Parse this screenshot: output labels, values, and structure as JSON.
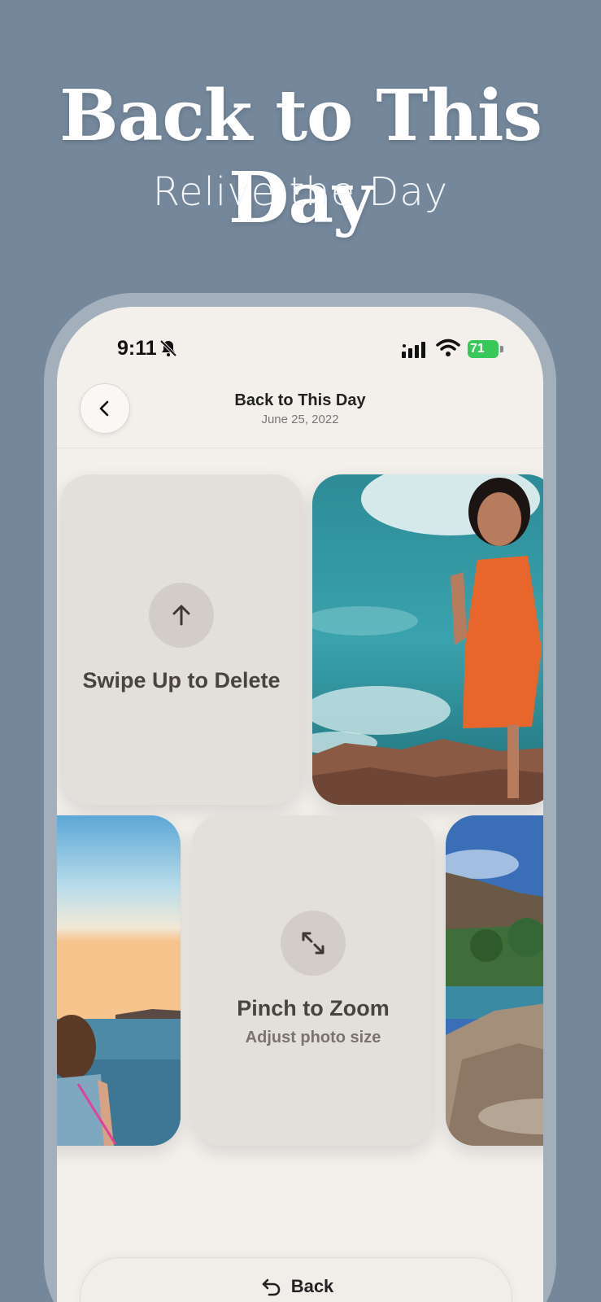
{
  "promo": {
    "headline": "Back to This Day",
    "subheadline": "Relive the Day"
  },
  "status_bar": {
    "time": "9:11",
    "battery": "71",
    "icons": [
      "bell-slash-icon",
      "signal-icon",
      "wifi-icon",
      "battery-icon"
    ]
  },
  "header": {
    "title": "Back to This Day",
    "date": "June 25, 2022",
    "back_icon": "chevron-left-icon"
  },
  "cards": {
    "swipe_hint": {
      "title": "Swipe Up to Delete",
      "icon": "arrow-up-icon"
    },
    "zoom_hint": {
      "title": "Pinch to Zoom",
      "subtitle": "Adjust photo size",
      "icon": "expand-arrows-icon"
    },
    "photos": [
      "woman-orange-dress-by-sea-photo",
      "woman-looking-at-sea-sunset-photo",
      "coastal-rocks-landscape-photo"
    ]
  },
  "footer": {
    "back_label": "Back",
    "back_icon": "undo-arrow-icon"
  },
  "colors": {
    "background": "#74879b",
    "screen": "#f3f0ec",
    "hint_card": "#e3e0dc",
    "battery": "#38c759"
  }
}
